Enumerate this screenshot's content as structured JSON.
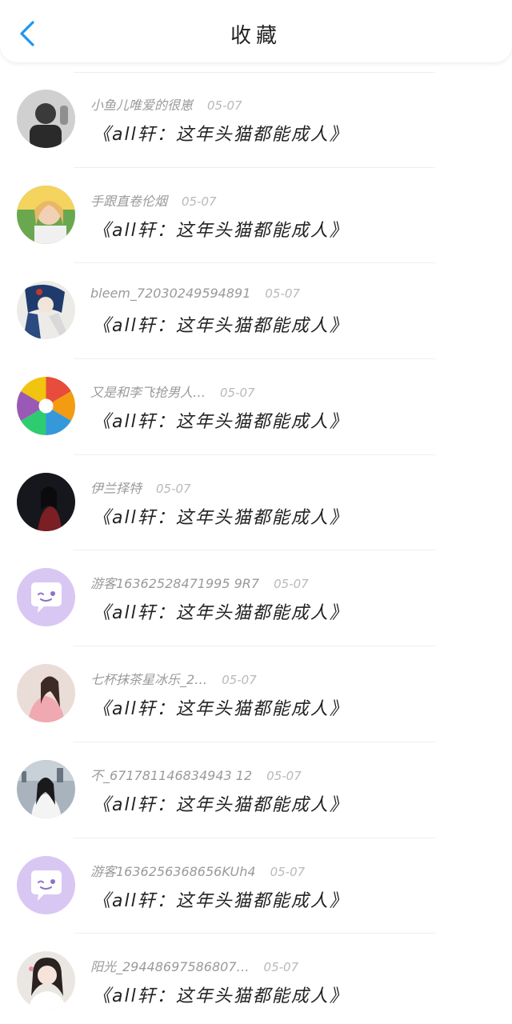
{
  "header": {
    "title": "收藏"
  },
  "items": [
    {
      "username": "小鱼儿唯爱的很崽",
      "time": "05-07",
      "book": "《all轩：这年头猫都能成人》",
      "avatar_bg": "#cfcfcf"
    },
    {
      "username": "手跟直卷伦烟",
      "time": "05-07",
      "book": "《all轩：这年头猫都能成人》",
      "avatar_bg": "#e8c9a8"
    },
    {
      "username": "bleem_72030249594891",
      "time": "05-07",
      "book": "《all轩：这年头猫都能成人》",
      "avatar_bg": "#e6e3e0"
    },
    {
      "username": "又是和李飞抢男人…",
      "time": "05-07",
      "book": "《all轩：这年头猫都能成人》",
      "avatar_bg": "#e0b94e"
    },
    {
      "username": "伊兰择特",
      "time": "05-07",
      "book": "《all轩：这年头猫都能成人》",
      "avatar_bg": "#1b1b22"
    },
    {
      "username": "游客16362528471995 9R7",
      "time": "05-07",
      "book": "《all轩：这年头猫都能成人》",
      "avatar_bg": "#d8c6f2"
    },
    {
      "username": "七杯抹茶星冰乐_2…",
      "time": "05-07",
      "book": "《all轩：这年头猫都能成人》",
      "avatar_bg": "#e8c7c7"
    },
    {
      "username": "不_671781146834943 12",
      "time": "05-07",
      "book": "《all轩：这年头猫都能成人》",
      "avatar_bg": "#9aa3ad"
    },
    {
      "username": "游客1636256368656KUh4",
      "time": "05-07",
      "book": "《all轩：这年头猫都能成人》",
      "avatar_bg": "#d8c6f2"
    },
    {
      "username": "阳光_29448697586807…",
      "time": "05-07",
      "book": "《all轩：这年头猫都能成人》",
      "avatar_bg": "#efe9e4"
    }
  ]
}
